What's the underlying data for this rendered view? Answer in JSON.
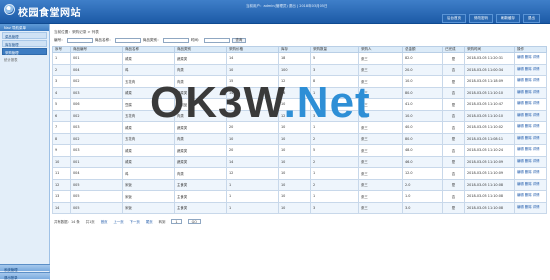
{
  "header": {
    "site_title": "校园食堂网站",
    "user_info": "当前用户：admin(管理员)  退出 | 2018年03月05日",
    "nav": [
      "后台首页",
      "修改密码",
      "刷新缓存",
      "退出"
    ]
  },
  "sidebar": {
    "heading": "Nav 导航菜单",
    "items": [
      "菜品管理",
      "库存管理",
      "采购管理",
      "统计报表"
    ],
    "bottom": [
      "系统管理",
      "退出登录"
    ]
  },
  "breadcrumb": "当前位置：采购记录 > 列表",
  "search": {
    "label_id": "编号：",
    "label_name": "商品名称：",
    "label_cat": "商品类别：",
    "label_time": "时间：",
    "button": "查询"
  },
  "table": {
    "headers": [
      "序号",
      "商品编号",
      "商品名称",
      "商品类别",
      "采购价格",
      "库存",
      "采购数量",
      "采购人",
      "总金额",
      "已完成",
      "采购时间",
      "操作"
    ],
    "rows": [
      [
        "1",
        "001",
        "咸菜",
        "蔬菜类",
        "14",
        "18",
        "5",
        "张三",
        "82.0",
        "是",
        "2018-03-05 11:20:31",
        "编辑 删除 详情"
      ],
      [
        "2",
        "004",
        "鸡",
        "肉类",
        "10",
        "100",
        "3",
        "张三",
        "20.0",
        "否",
        "2018-03-05 11:00:34",
        "编辑 删除 详情"
      ],
      [
        "3",
        "002",
        "五花肉",
        "肉类",
        "15",
        "12",
        "8",
        "张三",
        "10.0",
        "是",
        "2018-03-05 11:18:09",
        "编辑 删除 详情"
      ],
      [
        "4",
        "003",
        "咸菜",
        "蔬菜类",
        "14",
        "76",
        "1",
        "张三",
        "80.0",
        "否",
        "2018-03-05 11:10:10",
        "编辑 删除 详情"
      ],
      [
        "5",
        "006",
        "豆腐",
        "豆制品",
        "13",
        "10",
        "1",
        "张三",
        "41.0",
        "是",
        "2018-03-05 11:10:47",
        "编辑 删除 详情"
      ],
      [
        "6",
        "002",
        "五花肉",
        "肉类",
        "12",
        "12",
        "3",
        "张三",
        "10.0",
        "否",
        "2018-03-05 11:10:10",
        "编辑 删除 详情"
      ],
      [
        "7",
        "003",
        "咸菜",
        "蔬菜类",
        "20",
        "10",
        "1",
        "张三",
        "40.0",
        "否",
        "2018-03-05 11:10:02",
        "编辑 删除 详情"
      ],
      [
        "8",
        "002",
        "五花肉",
        "肉类",
        "10",
        "10",
        "2",
        "张三",
        "80.0",
        "是",
        "2018-03-05 11:08:11",
        "编辑 删除 详情"
      ],
      [
        "9",
        "003",
        "咸菜",
        "蔬菜类",
        "20",
        "10",
        "5",
        "张三",
        "48.0",
        "否",
        "2018-03-05 11:10:24",
        "编辑 删除 详情"
      ],
      [
        "10",
        "001",
        "咸菜",
        "蔬菜类",
        "14",
        "10",
        "2",
        "张三",
        "46.0",
        "是",
        "2018-03-05 11:10:09",
        "编辑 删除 详情"
      ],
      [
        "11",
        "004",
        "鸡",
        "肉类",
        "12",
        "10",
        "1",
        "张三",
        "12.0",
        "否",
        "2018-03-05 11:10:09",
        "编辑 删除 详情"
      ],
      [
        "12",
        "005",
        "米饭",
        "主食类",
        "1",
        "10",
        "2",
        "张三",
        "2.0",
        "是",
        "2018-03-05 11:10:08",
        "编辑 删除 详情"
      ],
      [
        "13",
        "005",
        "米饭",
        "主食类",
        "1",
        "10",
        "1",
        "张三",
        "1.0",
        "否",
        "2018-03-05 11:10:08",
        "编辑 删除 详情"
      ],
      [
        "14",
        "005",
        "米饭",
        "主食类",
        "1",
        "10",
        "3",
        "张三",
        "3.0",
        "是",
        "2018-03-05 11:10:08",
        "编辑 删除 详情"
      ]
    ]
  },
  "pager": {
    "summary": "共有数据：14 条",
    "pages": "共1页",
    "first": "首页",
    "prev": "上一页",
    "next": "下一页",
    "last": "尾页",
    "go": "转到",
    "current": "1",
    "go_btn": "GO"
  },
  "watermark": {
    "left": "OK3W",
    "right": ".Net"
  },
  "colors": {
    "header": "#1c5aa6",
    "accent": "#3d7cc2",
    "link": "#1a56a8"
  }
}
